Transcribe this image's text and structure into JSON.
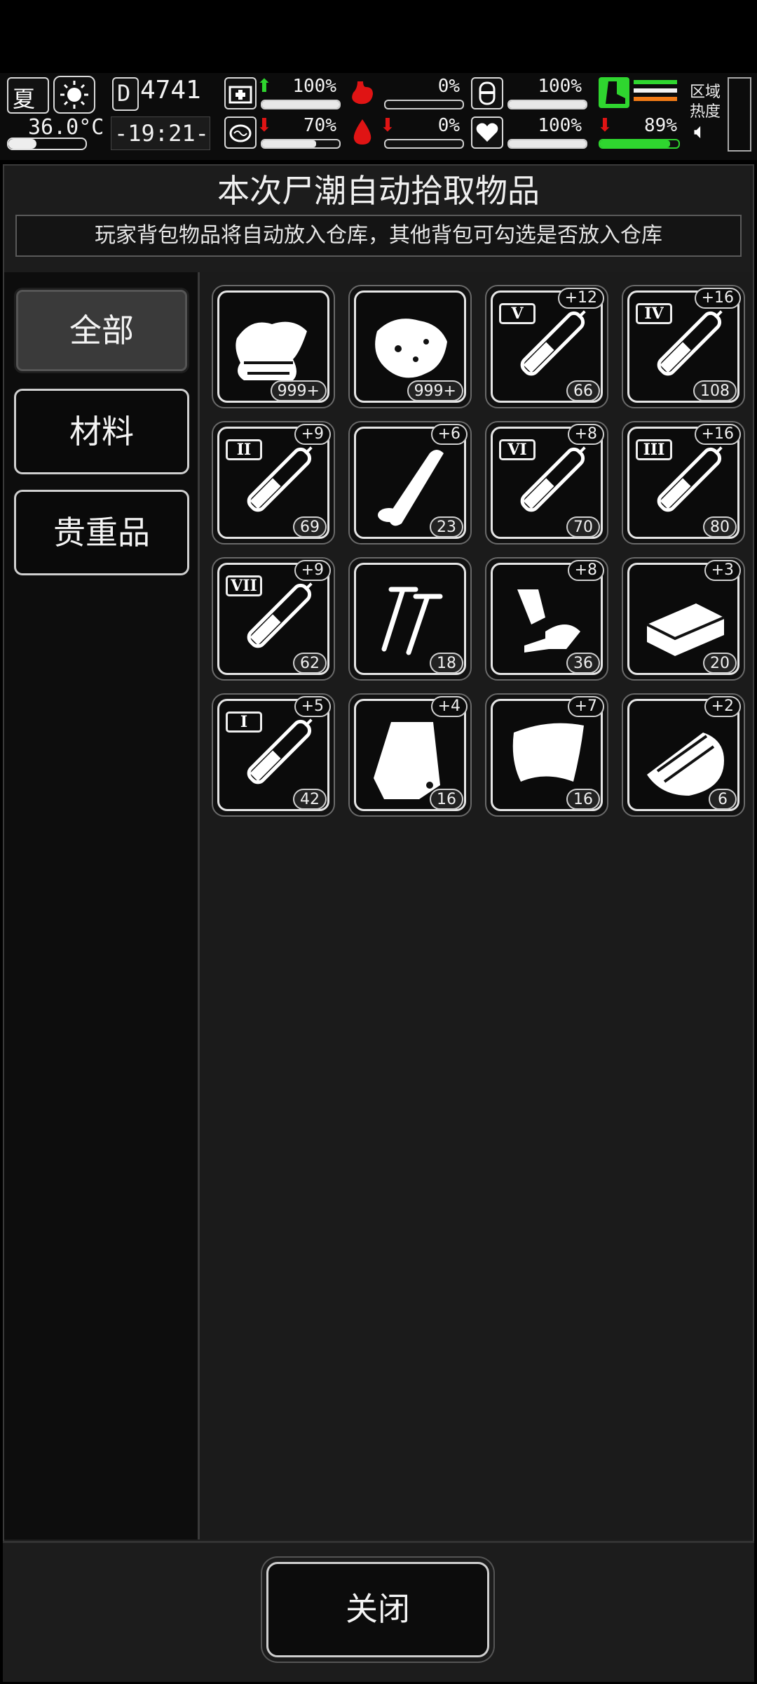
{
  "hud": {
    "season": "夏",
    "temperature": "36.0°C",
    "day": "4741",
    "time": "-19:21-",
    "stats": [
      {
        "name": "health",
        "pct": "100%",
        "level": 1.0,
        "trend": "up"
      },
      {
        "name": "hunger",
        "pct": "0%",
        "level": 0.0,
        "trend": "none"
      },
      {
        "name": "stamina",
        "pct": "100%",
        "level": 1.0,
        "trend": "none"
      },
      {
        "name": "sanity",
        "pct": "70%",
        "level": 0.7,
        "trend": "down"
      },
      {
        "name": "thirst",
        "pct": "0%",
        "level": 0.0,
        "trend": "down"
      },
      {
        "name": "heart",
        "pct": "100%",
        "level": 1.0,
        "trend": "none"
      }
    ],
    "fatigue_pct": "89%",
    "fatigue_level": 0.89,
    "zone_label": "区域\n热度",
    "colors": {
      "green": "#2fd62f",
      "orange": "#f07a16",
      "red": "#e01414"
    }
  },
  "dialog": {
    "title": "本次尸潮自动拾取物品",
    "subtitle": "玩家背包物品将自动放入仓库，其他背包可勾选是否放入仓库",
    "tabs": [
      {
        "label": "全部",
        "active": true
      },
      {
        "label": "材料",
        "active": false
      },
      {
        "label": "贵重品",
        "active": false
      }
    ],
    "close_label": "关闭"
  },
  "items": [
    {
      "icon": "cloth-icon",
      "count": "999+",
      "plus": ""
    },
    {
      "icon": "meat-chunk-icon",
      "count": "999+",
      "plus": ""
    },
    {
      "icon": "syringe-icon",
      "roman": "V",
      "count": "66",
      "plus": "+12"
    },
    {
      "icon": "syringe-icon",
      "roman": "IV",
      "count": "108",
      "plus": "+16"
    },
    {
      "icon": "syringe-icon",
      "roman": "II",
      "count": "69",
      "plus": "+9"
    },
    {
      "icon": "bone-icon",
      "count": "23",
      "plus": "+6"
    },
    {
      "icon": "syringe-icon",
      "roman": "VI",
      "count": "70",
      "plus": "+8"
    },
    {
      "icon": "syringe-icon",
      "roman": "III",
      "count": "80",
      "plus": "+16"
    },
    {
      "icon": "syringe-icon",
      "roman": "VII",
      "count": "62",
      "plus": "+9"
    },
    {
      "icon": "nails-icon",
      "count": "18",
      "plus": ""
    },
    {
      "icon": "scrap-parts-icon",
      "count": "36",
      "plus": "+8"
    },
    {
      "icon": "brick-icon",
      "count": "20",
      "plus": "+3"
    },
    {
      "icon": "syringe-icon",
      "roman": "I",
      "count": "42",
      "plus": "+5"
    },
    {
      "icon": "plastic-bag-icon",
      "count": "16",
      "plus": "+4"
    },
    {
      "icon": "leather-sheet-icon",
      "count": "16",
      "plus": "+7"
    },
    {
      "icon": "wood-planks-icon",
      "count": "6",
      "plus": "+2"
    }
  ]
}
